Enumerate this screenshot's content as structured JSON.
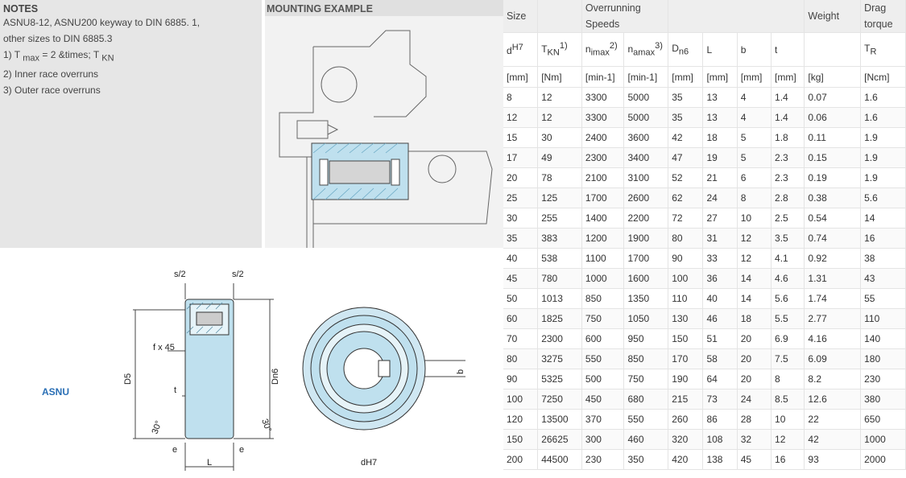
{
  "notes": {
    "heading": "NOTES",
    "lines": [
      "ASNU8-12, ASNU200 keyway to DIN 6885. 1,",
      "other sizes to DIN 6885.3",
      "1) T",
      "2) Inner race overruns",
      "3) Outer race overruns"
    ],
    "note1_a": "1) T",
    "note1_sub1": "max",
    "note1_b": " = 2 &times; T",
    "note1_sub2": "KN"
  },
  "mounting": {
    "heading": "MOUNTING EXAMPLE"
  },
  "drawing": {
    "label": "ASNU",
    "s2_left": "s/2",
    "s2_right": "s/2",
    "fx45": "f x 45",
    "d5": "D5",
    "dn6": "Dn6",
    "t": "t",
    "angle_left": "30°",
    "angle_right": "30°",
    "e_left": "e",
    "e_right": "e",
    "L": "L",
    "b": "b",
    "dh7": "dH7"
  },
  "table": {
    "head1": {
      "size": "Size",
      "speeds": "Overrunning Speeds",
      "weight": "Weight",
      "drag": "Drag torque"
    },
    "head2": {
      "d": "d",
      "d_sup": "H7",
      "tkn": "T",
      "tkn_sub": "KN",
      "tkn_sup": "1)",
      "nimax": "n",
      "nimax_sub": "imax",
      "nimax_sup": "2)",
      "namax": "n",
      "namax_sub": "amax",
      "namax_sup": "3)",
      "dn6": "D",
      "dn6_sub": "n6",
      "L": "L",
      "b": "b",
      "t": "t",
      "tr": "T",
      "tr_sub": "R"
    },
    "units": [
      "[mm]",
      "[Nm]",
      "[min-1]",
      "[min-1]",
      "[mm]",
      "[mm]",
      "[mm]",
      "[mm]",
      "[kg]",
      "[Ncm]"
    ],
    "rows": [
      [
        "8",
        "12",
        "3300",
        "5000",
        "35",
        "13",
        "4",
        "1.4",
        "0.07",
        "1.6"
      ],
      [
        "12",
        "12",
        "3300",
        "5000",
        "35",
        "13",
        "4",
        "1.4",
        "0.06",
        "1.6"
      ],
      [
        "15",
        "30",
        "2400",
        "3600",
        "42",
        "18",
        "5",
        "1.8",
        "0.11",
        "1.9"
      ],
      [
        "17",
        "49",
        "2300",
        "3400",
        "47",
        "19",
        "5",
        "2.3",
        "0.15",
        "1.9"
      ],
      [
        "20",
        "78",
        "2100",
        "3100",
        "52",
        "21",
        "6",
        "2.3",
        "0.19",
        "1.9"
      ],
      [
        "25",
        "125",
        "1700",
        "2600",
        "62",
        "24",
        "8",
        "2.8",
        "0.38",
        "5.6"
      ],
      [
        "30",
        "255",
        "1400",
        "2200",
        "72",
        "27",
        "10",
        "2.5",
        "0.54",
        "14"
      ],
      [
        "35",
        "383",
        "1200",
        "1900",
        "80",
        "31",
        "12",
        "3.5",
        "0.74",
        "16"
      ],
      [
        "40",
        "538",
        "1100",
        "1700",
        "90",
        "33",
        "12",
        "4.1",
        "0.92",
        "38"
      ],
      [
        "45",
        "780",
        "1000",
        "1600",
        "100",
        "36",
        "14",
        "4.6",
        "1.31",
        "43"
      ],
      [
        "50",
        "1013",
        "850",
        "1350",
        "110",
        "40",
        "14",
        "5.6",
        "1.74",
        "55"
      ],
      [
        "60",
        "1825",
        "750",
        "1050",
        "130",
        "46",
        "18",
        "5.5",
        "2.77",
        "110"
      ],
      [
        "70",
        "2300",
        "600",
        "950",
        "150",
        "51",
        "20",
        "6.9",
        "4.16",
        "140"
      ],
      [
        "80",
        "3275",
        "550",
        "850",
        "170",
        "58",
        "20",
        "7.5",
        "6.09",
        "180"
      ],
      [
        "90",
        "5325",
        "500",
        "750",
        "190",
        "64",
        "20",
        "8",
        "8.2",
        "230"
      ],
      [
        "100",
        "7250",
        "450",
        "680",
        "215",
        "73",
        "24",
        "8.5",
        "12.6",
        "380"
      ],
      [
        "120",
        "13500",
        "370",
        "550",
        "260",
        "86",
        "28",
        "10",
        "22",
        "650"
      ],
      [
        "150",
        "26625",
        "300",
        "460",
        "320",
        "108",
        "32",
        "12",
        "42",
        "1000"
      ],
      [
        "200",
        "44500",
        "230",
        "350",
        "420",
        "138",
        "45",
        "16",
        "93",
        "2000"
      ]
    ]
  }
}
